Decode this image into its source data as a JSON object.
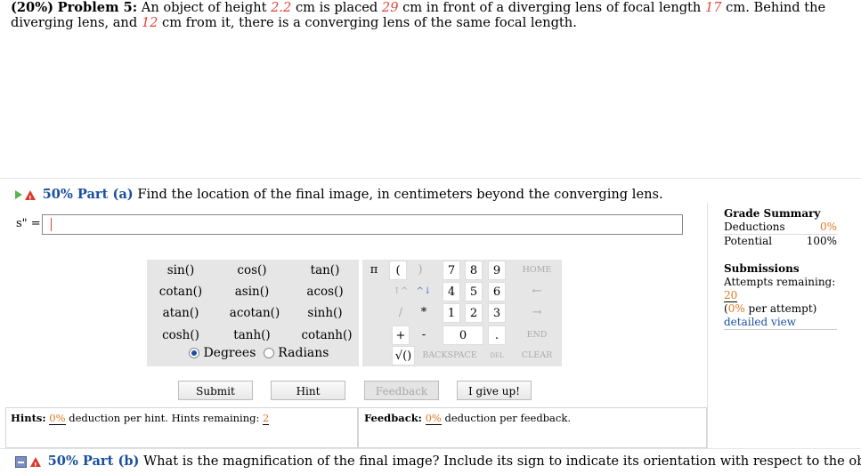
{
  "problem": {
    "pct": "(20%)",
    "label": "Problem 5:",
    "t1": " An object of height ",
    "height": "2.2",
    "t2": " cm is placed ",
    "dist": "29",
    "t3": " cm in front of a diverging lens of focal length ",
    "focal": "17",
    "t4": " cm. Behind the diverging lens, and ",
    "sep": "12",
    "t5": " cm from it, there is a converging lens of the same focal length."
  },
  "part_a": {
    "pct": "50% Part (a)",
    "text": "Find the location of the final image, in centimeters beyond the converging lens.",
    "var_label": "s\" ="
  },
  "part_b": {
    "pct": "50% Part (b)",
    "text": "What is the magnification of the final image? Include its sign to indicate its orientation with respect to the object."
  },
  "calc": {
    "functions": [
      [
        "sin()",
        "cos()",
        "tan()"
      ],
      [
        "cotan()",
        "asin()",
        "acos()"
      ],
      [
        "atan()",
        "acotan()",
        "sinh()"
      ],
      [
        "cosh()",
        "tanh()",
        "cotanh()"
      ]
    ],
    "degrees": "Degrees",
    "radians": "Radians",
    "keys": {
      "pi": "π",
      "lparen": "(",
      "rparen": ")",
      "k7": "7",
      "k8": "8",
      "k9": "9",
      "home": "HOME",
      "up": "↑^",
      "down": "^↓",
      "k4": "4",
      "k5": "5",
      "k6": "6",
      "left": "←",
      "div": "/",
      "mul": "*",
      "k1": "1",
      "k2": "2",
      "k3": "3",
      "right": "→",
      "plus": "+",
      "minus": "-",
      "k0": "0",
      "dot": ".",
      "end": "END",
      "sqrt": "√()",
      "backspace": "BACKSPACE",
      "del": "DEL",
      "clear": "CLEAR"
    }
  },
  "actions": {
    "submit": "Submit",
    "hint": "Hint",
    "feedback": "Feedback",
    "give_up": "I give up!"
  },
  "hints": {
    "label": "Hints:",
    "pct": "0%",
    "t1": " deduction per hint. Hints remaining:",
    "remaining": "2"
  },
  "feedback": {
    "label": "Feedback:",
    "pct": "0%",
    "t1": " deduction per feedback."
  },
  "grade": {
    "title": "Grade Summary",
    "deductions_label": "Deductions",
    "deductions_value": "0%",
    "potential_label": "Potential",
    "potential_value": "100%"
  },
  "submissions": {
    "title": "Submissions",
    "attempts_label": "Attempts remaining:",
    "attempts_value": "20",
    "per_attempt_open": "(",
    "per_attempt_pct": "0%",
    "per_attempt_close": " per attempt)",
    "detailed": "detailed view"
  },
  "colors": {
    "accent_blue": "#1a4fa0",
    "value_red": "#e0463c",
    "value_orange": "#e07820"
  }
}
